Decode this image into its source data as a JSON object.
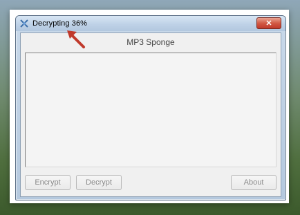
{
  "window": {
    "title": "Decrypting 36%",
    "close_label": "✕"
  },
  "app": {
    "name": "MP3 Sponge"
  },
  "buttons": {
    "encrypt": "Encrypt",
    "decrypt": "Decrypt",
    "about": "About"
  },
  "colors": {
    "arrow": "#c0392b",
    "close_button": "#c0392b"
  }
}
